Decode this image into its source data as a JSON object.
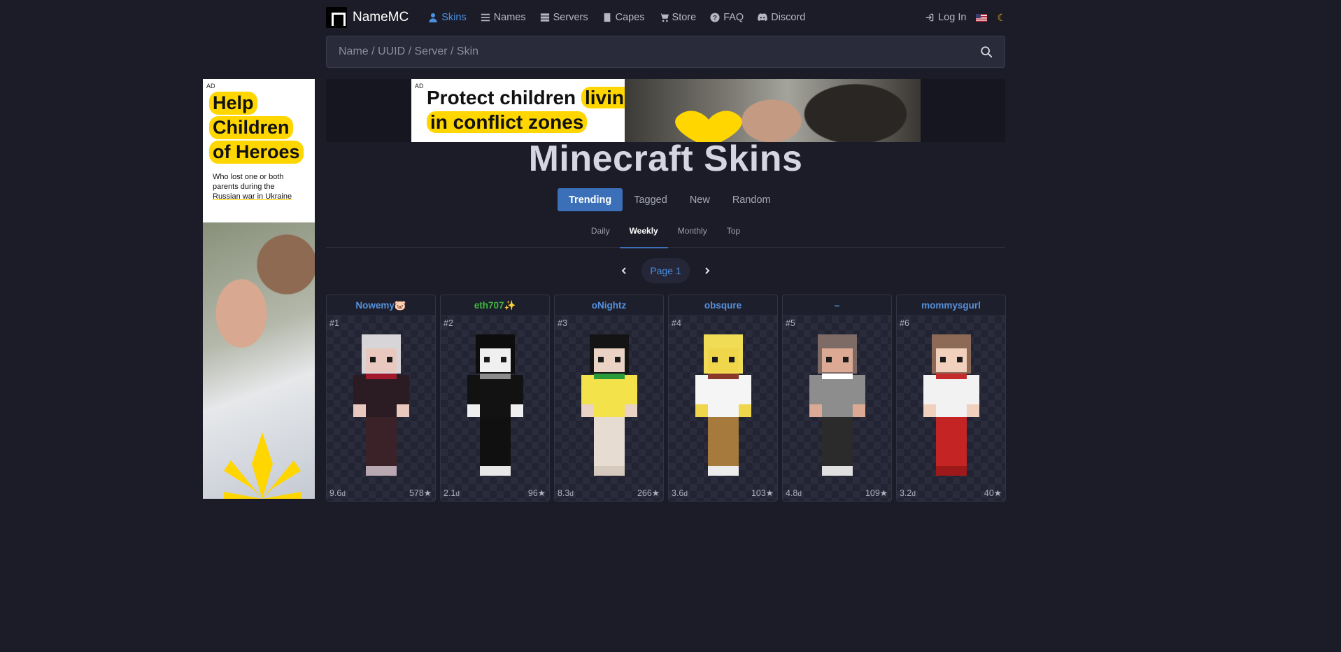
{
  "nav": {
    "brand": "NameMC",
    "items": [
      {
        "label": "Skins",
        "icon": "user-icon",
        "active": true
      },
      {
        "label": "Names",
        "icon": "list-icon",
        "active": false
      },
      {
        "label": "Servers",
        "icon": "server-icon",
        "active": false
      },
      {
        "label": "Capes",
        "icon": "cape-icon",
        "active": false
      },
      {
        "label": "Store",
        "icon": "cart-icon",
        "active": false
      },
      {
        "label": "FAQ",
        "icon": "question-icon",
        "active": false
      },
      {
        "label": "Discord",
        "icon": "discord-icon",
        "active": false
      }
    ],
    "login": "Log In",
    "flag_icon": "us-flag-icon",
    "theme_icon": "moon-icon",
    "active_color": "#4a8fe0"
  },
  "search": {
    "placeholder": "Name / UUID / Server / Skin",
    "icon": "search-icon"
  },
  "left_ad": {
    "tag": "AD",
    "headline": [
      "Help",
      "Children",
      "of Heroes"
    ],
    "sub_line1": "Who lost one or both",
    "sub_line2": "parents during the",
    "sub_line3": "Russian war in Ukraine"
  },
  "top_ad": {
    "tag": "AD",
    "line1_plain": "Protect children",
    "line1_highlight": "living",
    "line2_highlight": "in conflict zones"
  },
  "page_title": "Minecraft Skins",
  "tabs": [
    {
      "label": "Trending",
      "active": true
    },
    {
      "label": "Tagged",
      "active": false
    },
    {
      "label": "New",
      "active": false
    },
    {
      "label": "Random",
      "active": false
    }
  ],
  "subtabs": [
    {
      "label": "Daily",
      "active": false
    },
    {
      "label": "Weekly",
      "active": true
    },
    {
      "label": "Monthly",
      "active": false
    },
    {
      "label": "Top",
      "active": false
    }
  ],
  "pager": {
    "label": "Page 1"
  },
  "skins": [
    {
      "name": "Nowemy🐷",
      "name_color": "#5591dc",
      "rank": "#1",
      "age": "9.6",
      "age_unit": "d",
      "stars": "578★",
      "colors": {
        "hair": "#d8d5d8",
        "shirt": "#2a1c22",
        "accent": "#a3192c",
        "skin": "#e9c9bf",
        "pants": "#3a2228",
        "shoes": "#b9a8b2"
      }
    },
    {
      "name": "eth707✨",
      "name_color": "#3fb73f",
      "rank": "#2",
      "age": "2.1",
      "age_unit": "d",
      "stars": "96★",
      "colors": {
        "hair": "#0d0d0d",
        "shirt": "#121212",
        "accent": "#8c8c8c",
        "skin": "#f0f0f0",
        "pants": "#101010",
        "shoes": "#e8e8e8"
      }
    },
    {
      "name": "oNightz",
      "name_color": "#5591dc",
      "rank": "#3",
      "age": "8.3",
      "age_unit": "d",
      "stars": "266★",
      "colors": {
        "hair": "#141414",
        "shirt": "#f3e24a",
        "accent": "#2a9a3a",
        "skin": "#ead3c5",
        "pants": "#e6dcd2",
        "shoes": "#d6cabe"
      }
    },
    {
      "name": "obsqure",
      "name_color": "#5591dc",
      "rank": "#4",
      "age": "3.6",
      "age_unit": "d",
      "stars": "103★",
      "colors": {
        "hair": "#f1dd55",
        "shirt": "#f5f5f5",
        "accent": "#8a3a2a",
        "skin": "#f0d64a",
        "pants": "#a57a3c",
        "shoes": "#ececec"
      }
    },
    {
      "name": "–",
      "name_color": "#5591dc",
      "rank": "#5",
      "age": "4.8",
      "age_unit": "d",
      "stars": "109★",
      "colors": {
        "hair": "#7e6b66",
        "shirt": "#8d8d8d",
        "accent": "#ffffff",
        "skin": "#dcaa94",
        "pants": "#2b2b2b",
        "shoes": "#e0e0e0"
      }
    },
    {
      "name": "mommysgurl",
      "name_color": "#5591dc",
      "rank": "#6",
      "age": "3.2",
      "age_unit": "d",
      "stars": "40★",
      "colors": {
        "hair": "#8c6a55",
        "shirt": "#f2f2f2",
        "accent": "#c42b2b",
        "skin": "#f1d0bd",
        "pants": "#c42424",
        "shoes": "#9e1a1a"
      }
    }
  ]
}
